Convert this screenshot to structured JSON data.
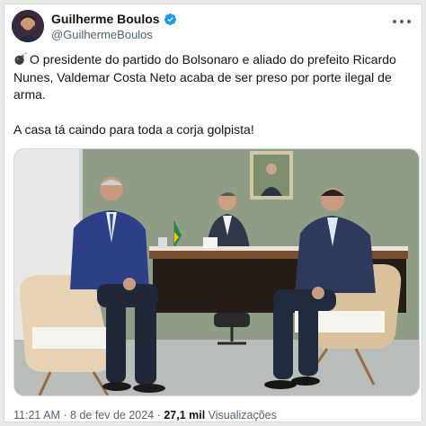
{
  "tweet": {
    "author": {
      "display_name": "Guilherme Boulos",
      "handle": "@GuilhermeBoulos",
      "verified": true
    },
    "text_line1": "O presidente do partido do Bolsonaro e aliado do prefeito Ricardo Nunes, Valdemar Costa Neto acaba de ser preso por porte ilegal de arma.",
    "text_line2": "A casa tá caindo para toda a corja golpista!",
    "leading_emoji": "bomb-icon",
    "media": {
      "type": "photo"
    },
    "meta": {
      "time": "11:21 AM",
      "separator": "·",
      "date": "8 de fev de 2024",
      "views_count": "27,1 mil",
      "views_label": "Visualizações"
    }
  },
  "colors": {
    "verified_badge": "#1d9bf0",
    "text_primary": "#0f1419",
    "text_secondary": "#536471",
    "wall_green": "#8f9c86"
  }
}
